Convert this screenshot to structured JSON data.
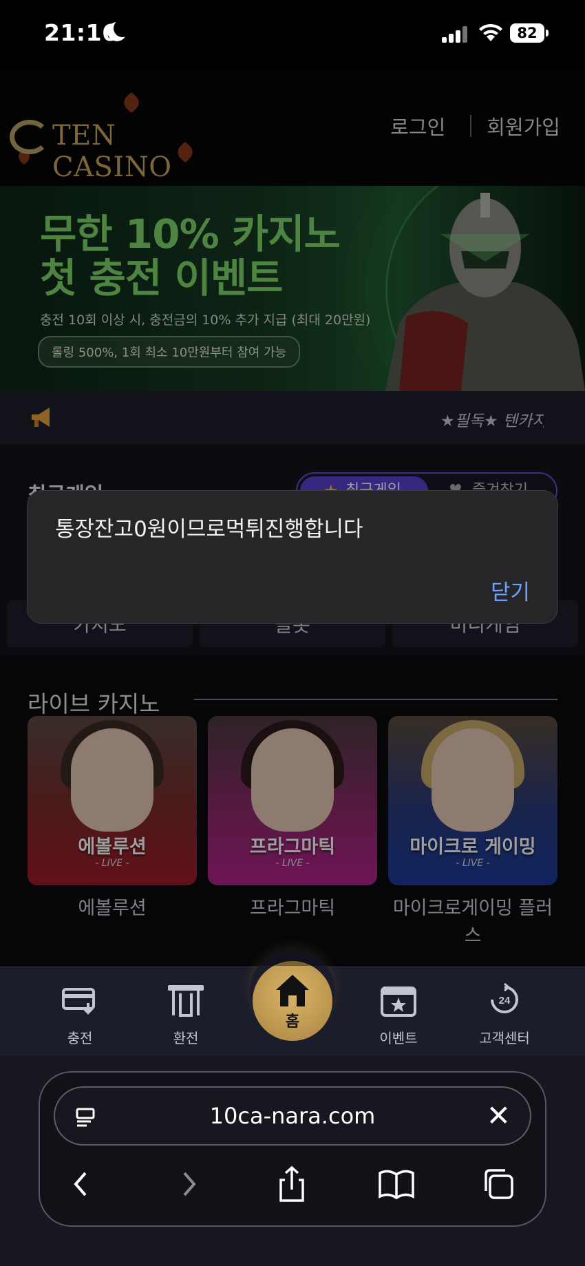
{
  "status_bar": {
    "time": "21:16",
    "battery": "82"
  },
  "header": {
    "logo_text": "TEN CASINO",
    "login": "로그인",
    "signup": "회원가입"
  },
  "banner": {
    "headline_line1": "무한 10% 카지노",
    "headline_line2": "첫 충전 이벤트",
    "subtitle": "충전 10회 이상 시, 충전금의 10% 추가 지급 (최대 20만원)",
    "pill": "롤링 500%, 1회 최소 10만원부터 참여 가능"
  },
  "notice": {
    "ticker": "★필독★ 텐카지"
  },
  "games": {
    "title": "최근게임",
    "toggle_active": "최근게임",
    "toggle_inactive": "즐겨찾기",
    "categories": [
      "카지노",
      "슬롯",
      "미니게임"
    ]
  },
  "modal": {
    "message": "통장잔고0원이므로먹튀진행합니다",
    "close": "닫기"
  },
  "live_casino": {
    "title": "라이브 카지노",
    "cards": [
      {
        "brand": "에볼루션",
        "tag": "- LIVE -",
        "label": "에볼루션",
        "color": "#9e1b2a"
      },
      {
        "brand": "프라그마틱",
        "tag": "- LIVE -",
        "label": "프라그마틱",
        "color": "#b1238a"
      },
      {
        "brand": "마이크로 게이밍",
        "tag": "- LIVE -",
        "label": "마이크로게이밍 플러스",
        "color": "#1d3a9a"
      }
    ]
  },
  "bottom_nav": {
    "items": [
      {
        "label": "충전",
        "icon": "card-icon"
      },
      {
        "label": "환전",
        "icon": "withdraw-icon"
      },
      {
        "label": "홈",
        "icon": "home-icon"
      },
      {
        "label": "이벤트",
        "icon": "calendar-star-icon"
      },
      {
        "label": "고객센터",
        "icon": "support-24-icon"
      }
    ]
  },
  "safari": {
    "url": "10ca-nara.com"
  },
  "colors": {
    "accent_purple": "#5a3fcf",
    "gold": "#c9a75f",
    "link_blue": "#6aa4ff"
  }
}
